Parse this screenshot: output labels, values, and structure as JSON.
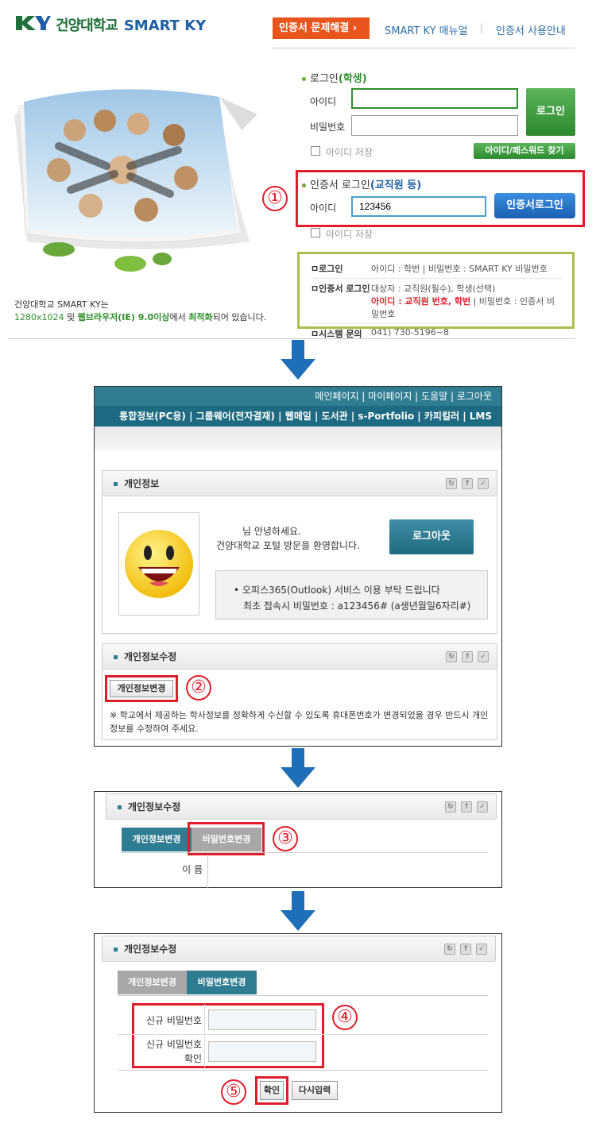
{
  "header": {
    "logo_text": "건양대학교",
    "logo_sub": "SMART KY",
    "cert_trouble": "인증서 문제해결 ›",
    "manual_link": "SMART KY 매뉴얼",
    "cert_guide_link": "인증서 사용안내",
    "separator": "|"
  },
  "notice": {
    "line1": "건양대학교 SMART KY는",
    "res": "1280x1024",
    "mid": " 및 ",
    "browser": "웹브라우저(IE) 9.0이상",
    "mid2": "에서 ",
    "opt": "최적화",
    "tail": "되어 있습니다."
  },
  "student_login": {
    "title_prefix": "로그인",
    "title_highlight": "(학생)",
    "id_label": "아이디",
    "pw_label": "비밀번호",
    "id_value": "",
    "pw_value": "",
    "login_button": "로그인",
    "save_id": "아이디 저장",
    "find_button": "아이디/패스워드 찾기"
  },
  "cert_login": {
    "title_prefix": "인증서 로그인",
    "title_highlight": "(교직원 등)",
    "id_label": "아이디",
    "id_value": "123456",
    "button": "인증서로그인",
    "save_id": "아이디 저장"
  },
  "info_box": {
    "rows": [
      {
        "key": "로그인",
        "value": "아이디 : 학번  |  비밀번호 : SMART KY 비밀번호"
      },
      {
        "key": "인증서 로그인",
        "value_line1": "대상자 : 교직원(필수), 학생(선택)",
        "value_red": "아이디 : 교직원 번호, 학번",
        "value_tail": "  |  비밀번호 : 인증서 비밀번호"
      },
      {
        "key": "시스템 문의",
        "value": "041) 730-5196~8"
      }
    ],
    "bullet": "ㅁ"
  },
  "steps": {
    "one": "①",
    "two": "②",
    "three": "③",
    "four": "④",
    "five": "⑤"
  },
  "portal": {
    "top_nav": "메인페이지  |   마이페이지  |   도움말  |   로그아웃",
    "main_nav": "통합정보(PC용)  |  그룹웨어(전자결재)  |  웹메일  |  도서관  |  s-Portfolio  |  카피킬러  |  LMS",
    "personal_title": "개인정보",
    "greeting1": "님 안녕하세요.",
    "greeting2": "건양대학교 포털 방문을 환영합니다.",
    "logout_button": "로그아웃",
    "notice1": "•   오피스365(Outlook) 서비스 이용 부탁 드립니다",
    "notice2": "최초 접속시 비밀번호 : a123456# (a생년월일6자리#)",
    "edit_title": "개인정보수정",
    "edit_button": "개인정보변경",
    "edit_notice": "※ 학교에서 제공하는 학사정보를 정확하게 수신할 수 있도록 휴대폰번호가 변경되었을 경우 반드시 개인정보를 수정하여 주세요."
  },
  "step3": {
    "title": "개인정보수정",
    "tab1": "개인정보변경",
    "tab2": "비밀번호변경",
    "name_label": "이 름"
  },
  "step4": {
    "title": "개인정보수정",
    "tab1": "개인정보변경",
    "tab2": "비밀번호변경",
    "new_pw_label": "신규 비밀번호",
    "confirm_label_1": "신규 비밀번호",
    "confirm_label_2": "확인",
    "new_pw_value": "",
    "confirm_value": "",
    "ok_button": "확인",
    "reset_button": "다시입력"
  },
  "colors": {
    "accent_green": "#2f8f2f",
    "accent_blue": "#1d5fa3",
    "highlight_red": "#e01e2b",
    "portal_teal": "#2f7d93",
    "cert_orange": "#e8541c"
  }
}
